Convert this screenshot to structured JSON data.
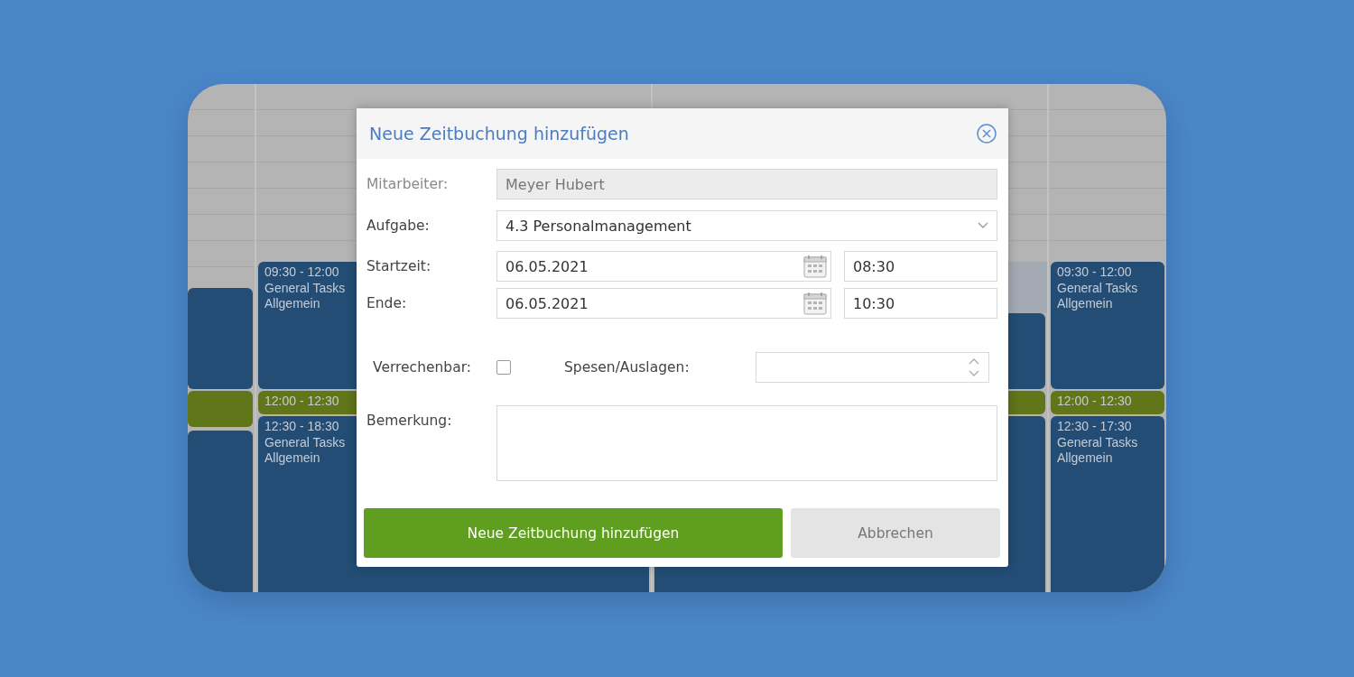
{
  "calendar": {
    "columns": [
      {
        "events": [
          {
            "kind": "task"
          },
          {
            "kind": "break"
          },
          {
            "kind": "task"
          }
        ]
      },
      {
        "events": [
          {
            "kind": "task",
            "time": "09:30 - 12:00",
            "title": "General Tasks",
            "category": "Allgemein"
          },
          {
            "kind": "break",
            "time": "12:00 - 12:30"
          },
          {
            "kind": "task",
            "time": "12:30 - 18:30",
            "title": "General Tasks",
            "category": "Allgemein"
          }
        ]
      },
      {
        "events": [
          {
            "kind": "task"
          },
          {
            "kind": "break"
          },
          {
            "kind": "task"
          }
        ]
      },
      {
        "events": [
          {
            "kind": "task",
            "time": "09:30 - 12:00",
            "title": "General Tasks",
            "category": "Allgemein"
          },
          {
            "kind": "break",
            "time": "12:00 - 12:30"
          },
          {
            "kind": "task",
            "time": "12:30 - 17:30",
            "title": "General Tasks",
            "category": "Allgemein"
          }
        ]
      }
    ]
  },
  "dialog": {
    "title": "Neue Zeitbuchung hinzufügen",
    "employee": {
      "label": "Mitarbeiter:",
      "value": "Meyer Hubert",
      "disabled": true
    },
    "task": {
      "label": "Aufgabe:",
      "value": "4.3 Personalmanagement"
    },
    "start": {
      "label": "Startzeit:",
      "date": "06.05.2021",
      "time": "08:30"
    },
    "end": {
      "label": "Ende:",
      "date": "06.05.2021",
      "time": "10:30"
    },
    "billable": {
      "label": "Verrechenbar:",
      "checked": false
    },
    "expenses": {
      "label": "Spesen/Auslagen:"
    },
    "remark": {
      "label": "Bemerkung:"
    },
    "buttons": [
      {
        "label": "Neue Zeitbuchung hinzufügen",
        "kind": "primary"
      },
      {
        "label": "Abbrechen",
        "kind": "secondary"
      }
    ]
  }
}
